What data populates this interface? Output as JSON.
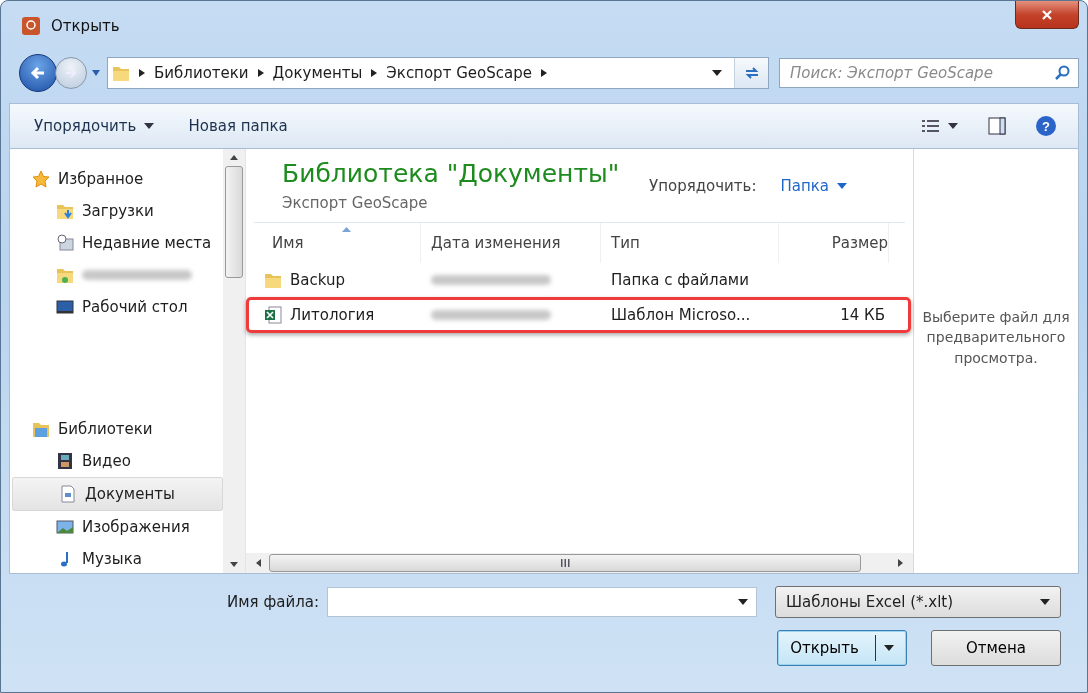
{
  "window": {
    "title": "Открыть"
  },
  "address": {
    "crumbs": [
      "Библиотеки",
      "Документы",
      "Экспорт GeoScape"
    ]
  },
  "search": {
    "placeholder": "Поиск: Экспорт GeoScape"
  },
  "toolbar": {
    "items": [
      "Упорядочить",
      "Новая папка"
    ],
    "help": "?"
  },
  "nav": {
    "groups": [
      {
        "label": "Избранное",
        "kind": "star",
        "selected": false,
        "children": [
          {
            "label": "Загрузки",
            "kind": "downloads",
            "selected": false
          },
          {
            "label": "Недавние места",
            "kind": "recent",
            "selected": false
          },
          {
            "kind": "user",
            "blurred": true,
            "selected": false
          },
          {
            "label": "Рабочий стол",
            "kind": "desktop",
            "selected": false
          }
        ]
      },
      {
        "label": "Библиотеки",
        "kind": "library",
        "selected": false,
        "children": [
          {
            "label": "Видео",
            "kind": "video",
            "selected": false
          },
          {
            "label": "Документы",
            "kind": "documents",
            "selected": true
          },
          {
            "label": "Изображения",
            "kind": "pictures",
            "selected": false
          },
          {
            "label": "Музыка",
            "kind": "music",
            "selected": false
          }
        ]
      }
    ]
  },
  "library": {
    "title": "Библиотека \"Документы\"",
    "subtitle": "Экспорт GeoScape",
    "arrange_label": "Упорядочить:",
    "arrange_value": "Папка"
  },
  "table": {
    "columns": [
      {
        "label": "Имя",
        "sorted": true
      },
      {
        "label": "Дата изменения",
        "sorted": false
      },
      {
        "label": "Тип",
        "sorted": false
      },
      {
        "label": "Размер",
        "sorted": false
      }
    ],
    "rows": [
      {
        "kind": "folder",
        "name": "Backup",
        "date_blurred": true,
        "type": "Папка с файлами",
        "highlighted": false
      },
      {
        "kind": "excel",
        "name": "Литология",
        "date_blurred": true,
        "type": "Шаблон Microso...",
        "size": "14 КБ",
        "highlighted": true
      }
    ]
  },
  "preview": {
    "text": "Выберите файл для предварительного просмотра."
  },
  "filename": {
    "label": "Имя файла:"
  },
  "filter": {
    "value": "Шаблоны Excel (*.xlt)"
  },
  "buttons": [
    {
      "label": "Открыть",
      "kind": "split"
    },
    {
      "label": "Отмена",
      "kind": "plain"
    }
  ]
}
